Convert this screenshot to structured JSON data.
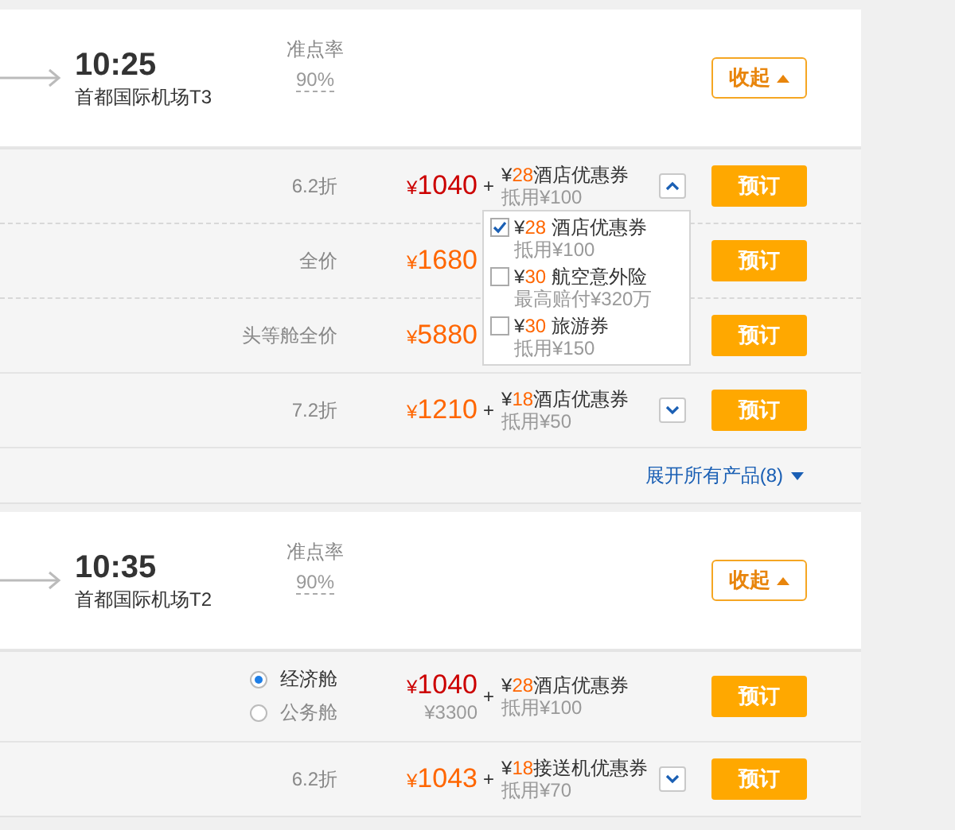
{
  "flights": [
    {
      "time": "10:25",
      "airport": "首都国际机场T3",
      "ontime_label": "准点率",
      "ontime_value": "90%",
      "collapse_button": "收起",
      "fares": [
        {
          "kind": "discount",
          "label": "6.2折",
          "currency": "¥",
          "price": "1040",
          "emphasis": true,
          "plus": "+",
          "coupon": {
            "currency": "¥",
            "amount": "28",
            "name": "酒店优惠券",
            "note": "抵用¥100"
          },
          "expanded": true,
          "book_button": "预订"
        },
        {
          "kind": "discount",
          "label": "全价",
          "currency": "¥",
          "price": "1680",
          "emphasis": false,
          "book_button": "预订"
        },
        {
          "kind": "discount",
          "label": "头等舱全价",
          "currency": "¥",
          "price": "5880",
          "emphasis": false,
          "book_button": "预订"
        },
        {
          "kind": "discount",
          "label": "7.2折",
          "currency": "¥",
          "price": "1210",
          "emphasis": false,
          "plus": "+",
          "coupon": {
            "currency": "¥",
            "amount": "18",
            "name": "酒店优惠券",
            "note": "抵用¥50"
          },
          "expanded": false,
          "book_button": "预订"
        }
      ],
      "coupon_menu": [
        {
          "checked": true,
          "currency": "¥",
          "amount": "28",
          "name": "酒店优惠券",
          "note": "抵用¥100"
        },
        {
          "checked": false,
          "currency": "¥",
          "amount": "30",
          "name": "航空意外险",
          "note": "最高赔付¥320万"
        },
        {
          "checked": false,
          "currency": "¥",
          "amount": "30",
          "name": "旅游券",
          "note": "抵用¥150"
        }
      ],
      "expand_link": "展开所有产品(8)"
    },
    {
      "time": "10:35",
      "airport": "首都国际机场T2",
      "ontime_label": "准点率",
      "ontime_value": "90%",
      "collapse_button": "收起",
      "fares": [
        {
          "kind": "cabin",
          "cabins": [
            {
              "label": "经济舱",
              "selected": true
            },
            {
              "label": "公务舱",
              "selected": false
            }
          ],
          "currency": "¥",
          "price": "1040",
          "emphasis": true,
          "alt_price": "¥3300",
          "plus": "+",
          "coupon": {
            "currency": "¥",
            "amount": "28",
            "name": "酒店优惠券",
            "note": "抵用¥100"
          },
          "book_button": "预订"
        },
        {
          "kind": "discount",
          "label": "6.2折",
          "currency": "¥",
          "price": "1043",
          "emphasis": false,
          "plus": "+",
          "coupon": {
            "currency": "¥",
            "amount": "18",
            "name": "接送机优惠券",
            "note": "抵用¥70"
          },
          "expanded": false,
          "book_button": "预订"
        }
      ]
    }
  ]
}
